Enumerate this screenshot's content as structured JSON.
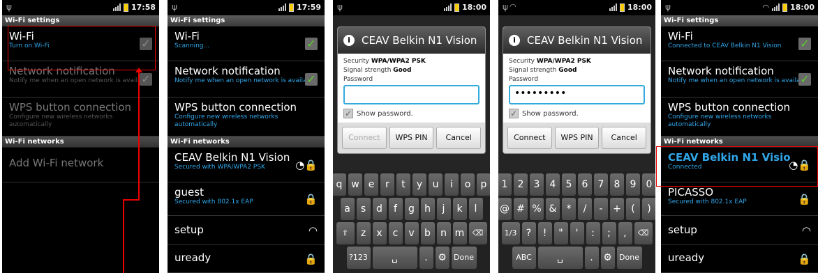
{
  "colors": {
    "accent": "#31a5e7",
    "check": "#5cd02a",
    "annotation": "#e00000"
  },
  "screens": [
    {
      "time": "17:58",
      "header": "Wi-Fi settings",
      "wifi": {
        "title": "Wi-Fi",
        "sub": "Turn on Wi-Fi"
      },
      "notif": {
        "title": "Network notification",
        "sub": "Notify me when an open network is available"
      },
      "wps": {
        "title": "WPS button connection",
        "sub": "Configure new wireless networks automatically"
      },
      "networks_header": "Wi-Fi networks",
      "add": "Add Wi-Fi network"
    },
    {
      "time": "17:59",
      "header": "Wi-Fi settings",
      "wifi": {
        "title": "Wi-Fi",
        "sub": "Scanning..."
      },
      "notif": {
        "title": "Network notification",
        "sub": "Notify me when an open network is available"
      },
      "wps": {
        "title": "WPS button connection",
        "sub": "Configure new wireless networks automatically"
      },
      "networks_header": "Wi-Fi networks",
      "networks": [
        {
          "name": "CEAV Belkin N1 Vision",
          "sub": "Secured with WPA/WPA2 PSK"
        },
        {
          "name": "guest",
          "sub": "Secured with 802.1x EAP"
        },
        {
          "name": "setup",
          "sub": ""
        },
        {
          "name": "uready",
          "sub": ""
        }
      ]
    },
    {
      "time": "18:00",
      "dialog": {
        "title": "CEAV Belkin N1 Vision",
        "security_label": "Security",
        "security": "WPA/WPA2 PSK",
        "signal_label": "Signal strength",
        "signal": "Good",
        "password_label": "Password",
        "password": "",
        "show": "Show password.",
        "connect": "Connect",
        "wps_pin": "WPS PIN",
        "cancel": "Cancel"
      },
      "keys": {
        "row1": [
          "q",
          "w",
          "e",
          "r",
          "t",
          "y",
          "u",
          "i",
          "o",
          "p"
        ],
        "row2": [
          "a",
          "s",
          "d",
          "f",
          "g",
          "h",
          "j",
          "k",
          "l"
        ],
        "row3": [
          "z",
          "x",
          "c",
          "v",
          "b",
          "n",
          "m"
        ],
        "shift": "⇧",
        "del": "⌫",
        "sym": "?123",
        "dot": ".",
        "gear": "⚙",
        "done": "Done"
      }
    },
    {
      "time": "18:00",
      "dialog": {
        "title": "CEAV Belkin N1 Vision",
        "security_label": "Security",
        "security": "WPA/WPA2 PSK",
        "signal_label": "Signal strength",
        "signal": "Good",
        "password_label": "Password",
        "password": "•••••••••",
        "show": "Show password.",
        "connect": "Connect",
        "wps_pin": "WPS PIN",
        "cancel": "Cancel"
      },
      "keys": {
        "row1": [
          "1",
          "2",
          "3",
          "4",
          "5",
          "6",
          "7",
          "8",
          "9",
          "0"
        ],
        "row2": [
          "@",
          "#",
          "%",
          "&",
          "*",
          "/",
          "-",
          "+",
          "(",
          ")"
        ],
        "row3": [
          "?",
          "!",
          "\"",
          "'",
          ":",
          ";",
          ","
        ],
        "page": "1/3",
        "del": "⌫",
        "abc": "ABC",
        "dot": ".",
        "gear": "⚙",
        "done": "Done"
      }
    },
    {
      "time": "18:00",
      "header": "Wi-Fi settings",
      "wifi": {
        "title": "Wi-Fi",
        "sub": "Connected to CEAV Belkin N1 Vision"
      },
      "notif": {
        "title": "Network notification",
        "sub": "Notify me when an open network is available"
      },
      "wps": {
        "title": "WPS button connection",
        "sub": "Configure new wireless networks automatically"
      },
      "networks_header": "Wi-Fi networks",
      "networks": [
        {
          "name": "CEAV Belkin N1 Visio",
          "sub": "Connected"
        },
        {
          "name": "PICASSO",
          "sub": "Secured with 802.1x EAP"
        },
        {
          "name": "setup",
          "sub": ""
        },
        {
          "name": "uready",
          "sub": ""
        }
      ]
    }
  ]
}
